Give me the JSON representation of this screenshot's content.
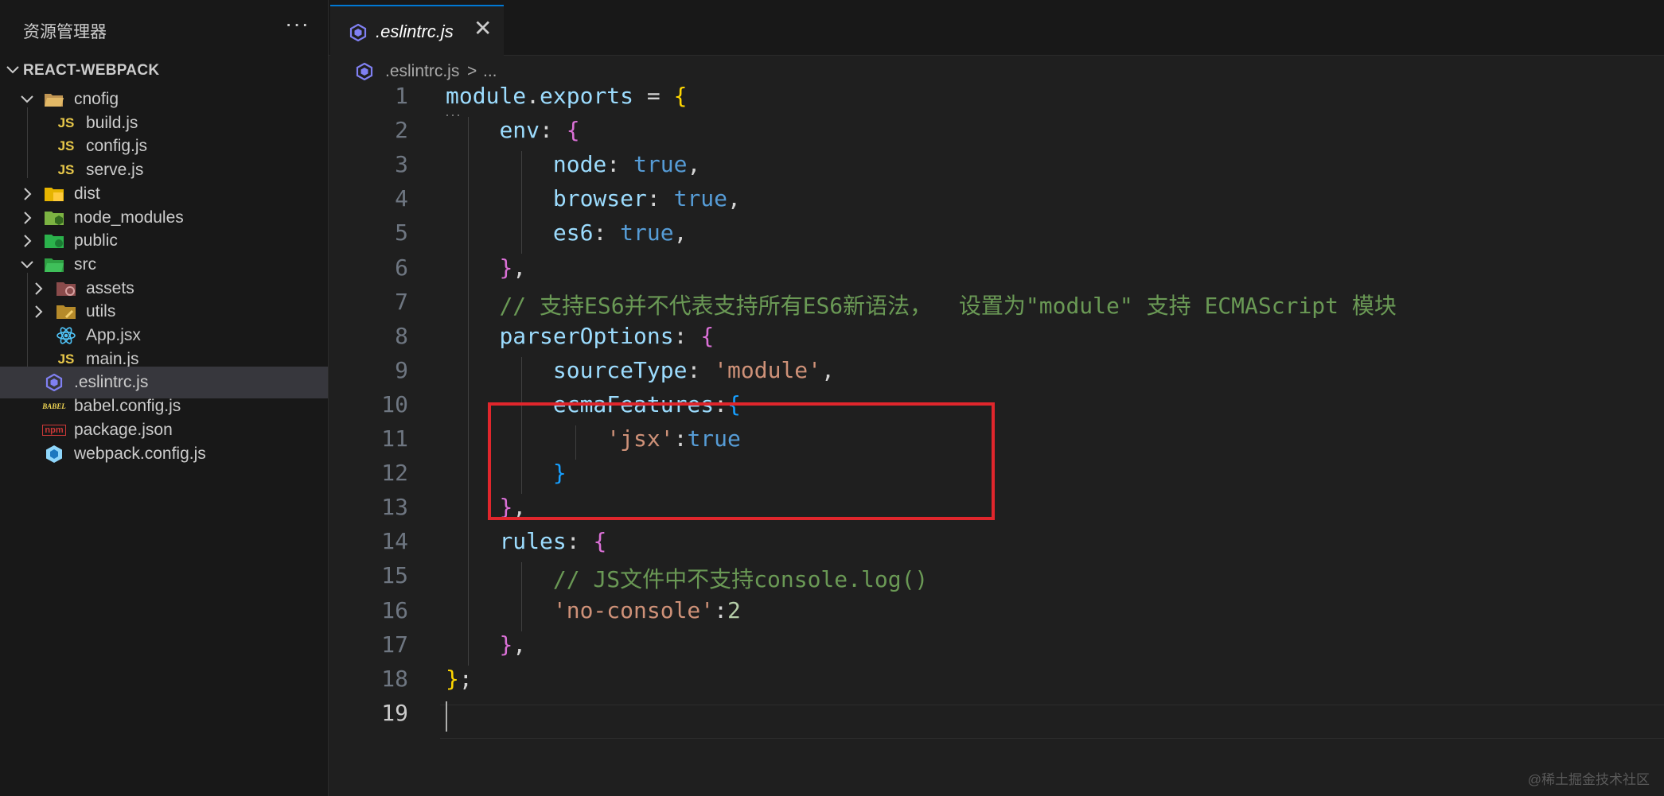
{
  "sidebar": {
    "title": "资源管理器",
    "more": "···",
    "project": "REACT-WEBPACK",
    "items": [
      {
        "label": "cnofig",
        "type": "folder-open",
        "icon": "config-folder-icon"
      },
      {
        "label": "build.js",
        "type": "file",
        "icon": "js-file-icon",
        "badge": "JS"
      },
      {
        "label": "config.js",
        "type": "file",
        "icon": "js-file-icon",
        "badge": "JS"
      },
      {
        "label": "serve.js",
        "type": "file",
        "icon": "js-file-icon",
        "badge": "JS"
      },
      {
        "label": "dist",
        "type": "folder",
        "icon": "dist-folder-icon"
      },
      {
        "label": "node_modules",
        "type": "folder",
        "icon": "node-folder-icon"
      },
      {
        "label": "public",
        "type": "folder",
        "icon": "public-folder-icon"
      },
      {
        "label": "src",
        "type": "folder-open",
        "icon": "src-folder-icon"
      },
      {
        "label": "assets",
        "type": "folder",
        "icon": "assets-folder-icon"
      },
      {
        "label": "utils",
        "type": "folder",
        "icon": "utils-folder-icon"
      },
      {
        "label": "App.jsx",
        "type": "file",
        "icon": "react-file-icon"
      },
      {
        "label": "main.js",
        "type": "file",
        "icon": "js-file-icon",
        "badge": "JS"
      },
      {
        "label": ".eslintrc.js",
        "type": "file",
        "icon": "eslint-file-icon",
        "selected": true
      },
      {
        "label": "babel.config.js",
        "type": "file",
        "icon": "babel-file-icon",
        "badge": "BABEL"
      },
      {
        "label": "package.json",
        "type": "file",
        "icon": "npm-file-icon",
        "badge": "npm"
      },
      {
        "label": "webpack.config.js",
        "type": "file",
        "icon": "webpack-file-icon"
      }
    ]
  },
  "editor": {
    "tab_label": ".eslintrc.js",
    "close_glyph": "✕",
    "breadcrumb": {
      "file": ".eslintrc.js",
      "separator": ">",
      "more": "..."
    },
    "cursor_line": 19,
    "highlighted_lines": [
      14,
      17
    ],
    "lines": [
      {
        "n": "1",
        "tokens": [
          [
            "tk-var",
            "module"
          ],
          [
            "tk-p",
            "."
          ],
          [
            "tk-var",
            "exports"
          ],
          [
            "tk-p",
            " = "
          ],
          [
            "tk-b1",
            "{"
          ]
        ]
      },
      {
        "n": "2",
        "tokens": [
          [
            "tk-p",
            "    "
          ],
          [
            "tk-var",
            "env"
          ],
          [
            "tk-p",
            ": "
          ],
          [
            "tk-b2",
            "{"
          ]
        ]
      },
      {
        "n": "3",
        "tokens": [
          [
            "tk-p",
            "        "
          ],
          [
            "tk-var",
            "node"
          ],
          [
            "tk-p",
            ": "
          ],
          [
            "tk-kw",
            "true"
          ],
          [
            "tk-p",
            ","
          ]
        ]
      },
      {
        "n": "4",
        "tokens": [
          [
            "tk-p",
            "        "
          ],
          [
            "tk-var",
            "browser"
          ],
          [
            "tk-p",
            ": "
          ],
          [
            "tk-kw",
            "true"
          ],
          [
            "tk-p",
            ","
          ]
        ]
      },
      {
        "n": "5",
        "tokens": [
          [
            "tk-p",
            "        "
          ],
          [
            "tk-var",
            "es6"
          ],
          [
            "tk-p",
            ": "
          ],
          [
            "tk-kw",
            "true"
          ],
          [
            "tk-p",
            ","
          ]
        ]
      },
      {
        "n": "6",
        "tokens": [
          [
            "tk-p",
            "    "
          ],
          [
            "tk-b2",
            "}"
          ],
          [
            "tk-p",
            ","
          ]
        ]
      },
      {
        "n": "7",
        "tokens": [
          [
            "tk-p",
            "    "
          ],
          [
            "tk-cmt",
            "// 支持ES6并不代表支持所有ES6新语法，  设置为\"module\" 支持 ECMAScript 模块"
          ]
        ]
      },
      {
        "n": "8",
        "tokens": [
          [
            "tk-p",
            "    "
          ],
          [
            "tk-var",
            "parserOptions"
          ],
          [
            "tk-p",
            ": "
          ],
          [
            "tk-b2",
            "{"
          ]
        ]
      },
      {
        "n": "9",
        "tokens": [
          [
            "tk-p",
            "        "
          ],
          [
            "tk-var",
            "sourceType"
          ],
          [
            "tk-p",
            ": "
          ],
          [
            "tk-str",
            "'module'"
          ],
          [
            "tk-p",
            ","
          ]
        ]
      },
      {
        "n": "10",
        "tokens": [
          [
            "tk-p",
            "        "
          ],
          [
            "tk-var",
            "ecmaFeatures"
          ],
          [
            "tk-p",
            ":"
          ],
          [
            "tk-b3",
            "{"
          ]
        ]
      },
      {
        "n": "11",
        "tokens": [
          [
            "tk-p",
            "            "
          ],
          [
            "tk-str",
            "'jsx'"
          ],
          [
            "tk-p",
            ":"
          ],
          [
            "tk-kw",
            "true"
          ]
        ]
      },
      {
        "n": "12",
        "tokens": [
          [
            "tk-p",
            "        "
          ],
          [
            "tk-b3",
            "}"
          ]
        ]
      },
      {
        "n": "13",
        "tokens": [
          [
            "tk-p",
            "    "
          ],
          [
            "tk-b2",
            "}"
          ],
          [
            "tk-p",
            ","
          ]
        ]
      },
      {
        "n": "14",
        "tokens": [
          [
            "tk-p",
            "    "
          ],
          [
            "tk-var",
            "rules"
          ],
          [
            "tk-p",
            ": "
          ],
          [
            "tk-b2",
            "{"
          ]
        ]
      },
      {
        "n": "15",
        "tokens": [
          [
            "tk-p",
            "        "
          ],
          [
            "tk-cmt",
            "// JS文件中不支持console.log()"
          ]
        ]
      },
      {
        "n": "16",
        "tokens": [
          [
            "tk-p",
            "        "
          ],
          [
            "tk-str",
            "'no-console'"
          ],
          [
            "tk-p",
            ":"
          ],
          [
            "tk-num",
            "2"
          ]
        ]
      },
      {
        "n": "17",
        "tokens": [
          [
            "tk-p",
            "    "
          ],
          [
            "tk-b2",
            "}"
          ],
          [
            "tk-p",
            ","
          ]
        ]
      },
      {
        "n": "18",
        "tokens": [
          [
            "tk-b1",
            "}"
          ],
          [
            "tk-p",
            ";"
          ]
        ]
      },
      {
        "n": "19",
        "tokens": []
      }
    ]
  },
  "watermark": "@稀土掘金技术社区",
  "colors": {
    "highlight_box": "#e0262c",
    "selection": "#37373d",
    "tab_accent": "#0078d4"
  }
}
